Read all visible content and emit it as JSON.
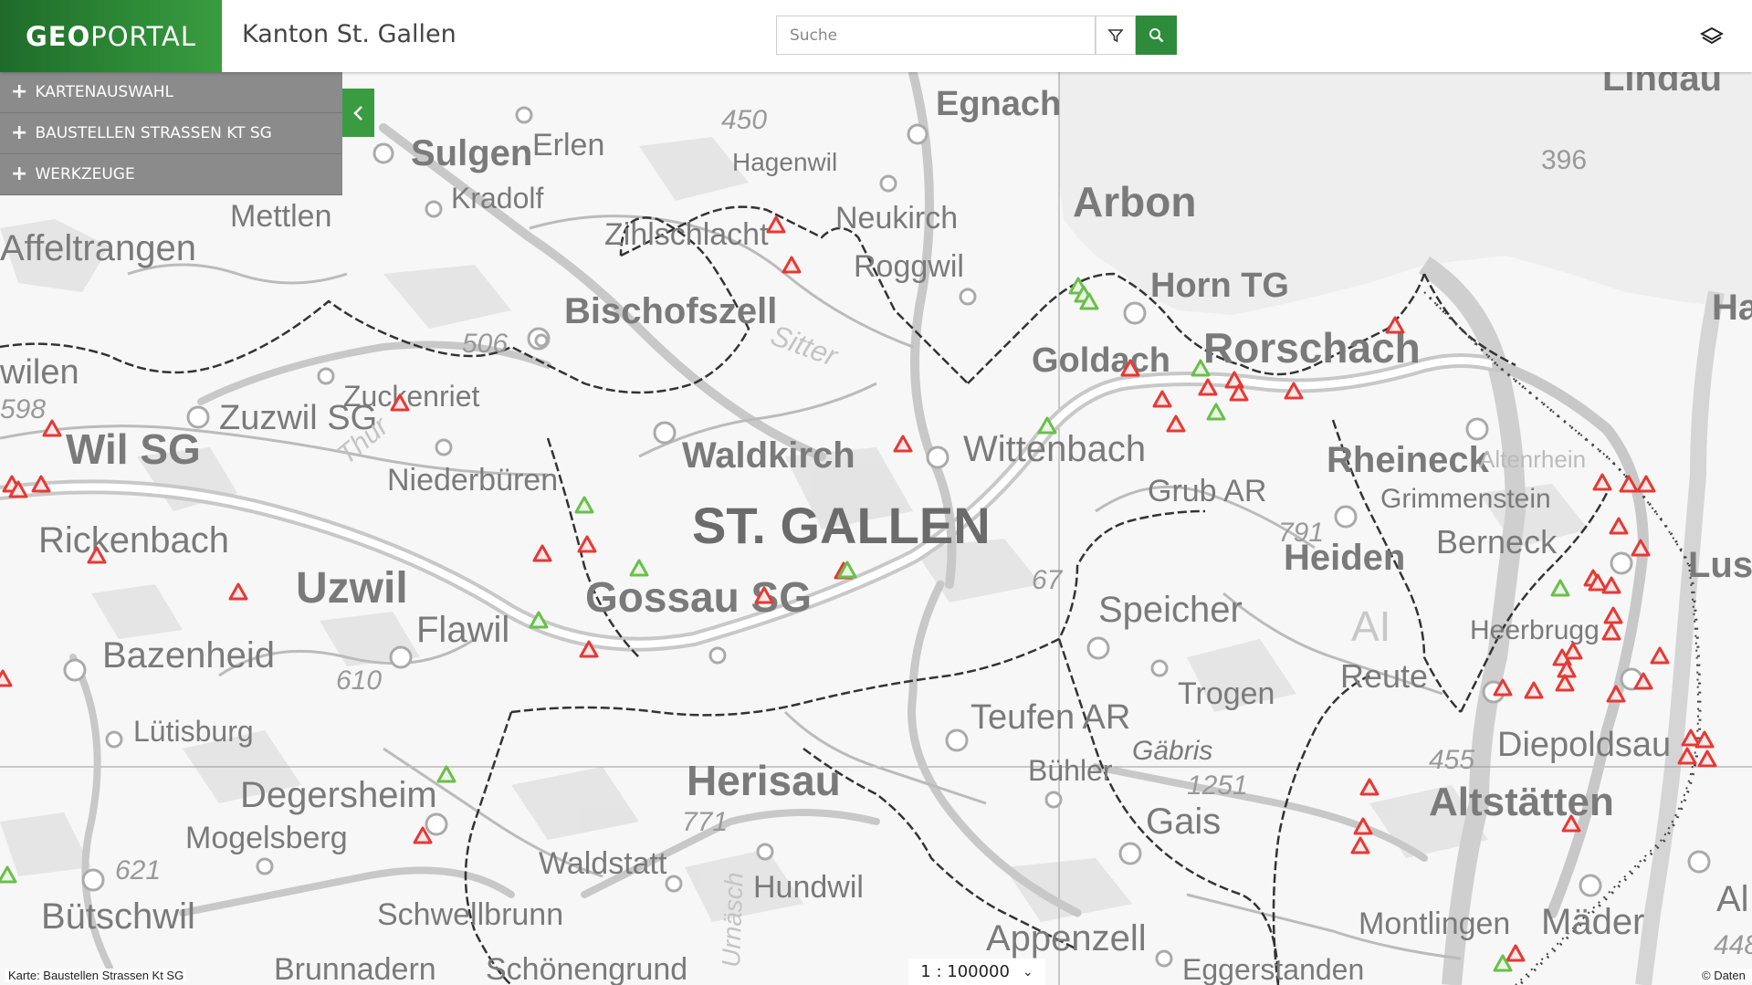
{
  "header": {
    "logo_bold": "GEO",
    "logo_rest": "PORTAL",
    "title": "Kanton St. Gallen",
    "search_placeholder": "Suche"
  },
  "sidebar": {
    "items": [
      {
        "label": "KARTENAUSWAHL"
      },
      {
        "label": "BAUSTELLEN STRASSEN KT SG"
      },
      {
        "label": "WERKZEUGE"
      }
    ]
  },
  "map": {
    "labels": [
      "Lindau",
      "Egnach",
      "Hagenwil",
      "Sulgen",
      "Erlen",
      "Kradolf",
      "Mettlen",
      "Affeltrangen",
      "Zihlschlacht",
      "Neukirch",
      "Roggwil",
      "Arbon",
      "Horn TG",
      "Bischofszell",
      "Rorschach",
      "Goldach",
      "wilen",
      "Wil SG",
      "Zuzwil SG",
      "Zuckenriet",
      "Niederbüren",
      "Waldkirch",
      "Wittenbach",
      "Rheineck",
      "Grub AR",
      "Grimmenstein",
      "Rickenbach",
      "ST. GALLEN",
      "Heiden",
      "Berneck",
      "Uzwil",
      "Gossau SG",
      "Speicher",
      "Flawil",
      "Bazenheid",
      "Lütisburg",
      "Trogen",
      "Reute",
      "Teufen AR",
      "Gäbris",
      "Diepoldsau",
      "Bühler",
      "Degersheim",
      "Herisau",
      "Altstätten",
      "Mogelsberg",
      "Gais",
      "Waldstatt",
      "Hundwil",
      "Bütschwil",
      "Schwellbrunn",
      "Montlingen",
      "Mäder",
      "Appenzell",
      "Brunnadern",
      "Schönengrund",
      "Eggerstanden",
      "Lus",
      "Ha",
      "Al",
      "Thur",
      "Sitter",
      "Urnäsch",
      "AI",
      "Heerbrugg",
      "Altenrhein"
    ],
    "heights": [
      "450",
      "396",
      "506",
      "598",
      "610",
      "67",
      "791",
      "621",
      "771",
      "1251",
      "455",
      "448"
    ],
    "marker_legend": {
      "red": "#e53935",
      "green": "#6abf4b"
    }
  },
  "footer": {
    "source": "Karte: Baustellen Strassen Kt SG",
    "copyright": "© Daten",
    "scale": "1 : 100000"
  },
  "colors": {
    "accent": "#2e8b3a",
    "panel": "#8b8b8b"
  }
}
